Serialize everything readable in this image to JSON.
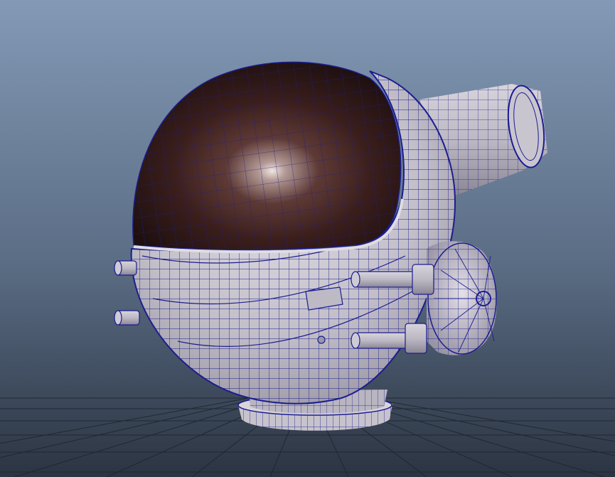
{
  "viewport": {
    "panel": "perspective",
    "shading": "wireframe-on-shaded",
    "background_top": "#8197b3",
    "background_bottom": "#2e3848",
    "grid_color": "#1e242c"
  },
  "scene": {
    "object": "space helmet",
    "visor_color": "#3a1f1c",
    "visor_highlight": "#e8ddd8",
    "shell_color": "#c9c5cd",
    "shell_shadow": "#8f8b98",
    "wire_color": "#1b1d8f"
  }
}
